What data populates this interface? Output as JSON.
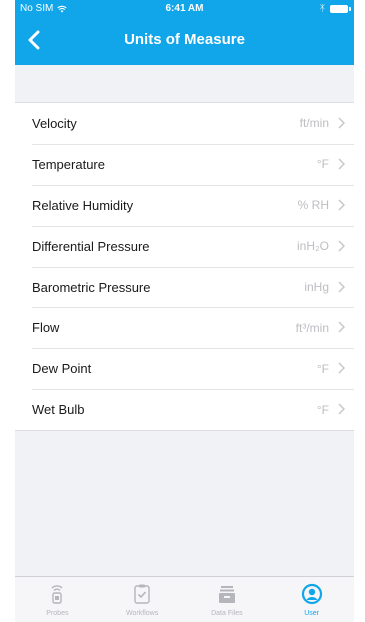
{
  "status_bar": {
    "carrier": "No SIM",
    "time": "6:41 AM"
  },
  "nav": {
    "title": "Units of Measure",
    "back_icon": "chevron-left-icon"
  },
  "units": [
    {
      "label": "Velocity",
      "value": "ft/min"
    },
    {
      "label": "Temperature",
      "value": "°F"
    },
    {
      "label": "Relative Humidity",
      "value": "% RH"
    },
    {
      "label": "Differential Pressure",
      "value": "inH₂O"
    },
    {
      "label": "Barometric Pressure",
      "value": "inHg"
    },
    {
      "label": "Flow",
      "value": "ft³/min"
    },
    {
      "label": "Dew Point",
      "value": "°F"
    },
    {
      "label": "Wet Bulb",
      "value": "°F"
    }
  ],
  "tab_bar": {
    "active_color": "#10a6e9",
    "inactive_color": "#b5b6bb",
    "tabs": [
      {
        "label": "Probes",
        "icon": "probe-icon",
        "active": false
      },
      {
        "label": "Workflows",
        "icon": "clipboard-icon",
        "active": false
      },
      {
        "label": "Data Files",
        "icon": "data-files-icon",
        "active": false
      },
      {
        "label": "User",
        "icon": "user-icon",
        "active": true
      }
    ]
  },
  "colors": {
    "brand_blue": "#10a6e9",
    "background": "#f1f2f6"
  }
}
